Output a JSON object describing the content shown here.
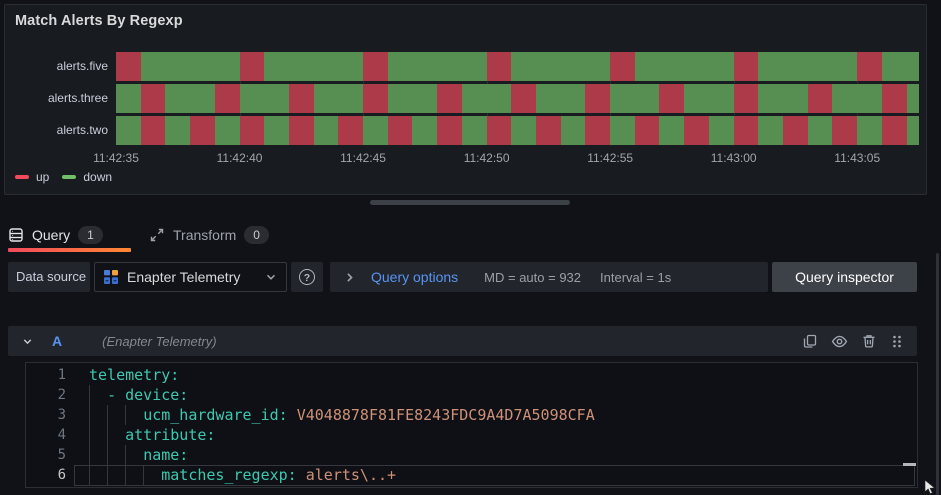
{
  "panel": {
    "title": "Match Alerts By Regexp"
  },
  "chart_data": {
    "type": "state_timeline",
    "title": "Match Alerts By Regexp",
    "x_start_s": 35,
    "x_end_s": 67.5,
    "cell_duration_s": 1,
    "ticks": [
      {
        "label": "11:42:35",
        "s": 35
      },
      {
        "label": "11:42:40",
        "s": 40
      },
      {
        "label": "11:42:45",
        "s": 45
      },
      {
        "label": "11:42:50",
        "s": 50
      },
      {
        "label": "11:42:55",
        "s": 55
      },
      {
        "label": "11:43:00",
        "s": 60
      },
      {
        "label": "11:43:05",
        "s": 65
      }
    ],
    "state_colors": {
      "up": "#ad3a49",
      "down": "#578e52"
    },
    "legend": [
      {
        "label": "up",
        "color": "#f2495c"
      },
      {
        "label": "down",
        "color": "#73bf69"
      }
    ],
    "series": [
      {
        "name": "alerts.five",
        "states": [
          "up",
          "down",
          "down",
          "down",
          "down",
          "up",
          "down",
          "down",
          "down",
          "down",
          "up",
          "down",
          "down",
          "down",
          "down",
          "up",
          "down",
          "down",
          "down",
          "down",
          "up",
          "down",
          "down",
          "down",
          "down",
          "up",
          "down",
          "down",
          "down",
          "down",
          "up",
          "down",
          "down"
        ]
      },
      {
        "name": "alerts.three",
        "states": [
          "down",
          "up",
          "down",
          "down",
          "up",
          "down",
          "down",
          "up",
          "down",
          "down",
          "up",
          "down",
          "down",
          "up",
          "down",
          "down",
          "up",
          "down",
          "down",
          "up",
          "down",
          "down",
          "up",
          "down",
          "down",
          "up",
          "down",
          "down",
          "up",
          "down",
          "down",
          "up",
          "down"
        ]
      },
      {
        "name": "alerts.two",
        "states": [
          "down",
          "up",
          "down",
          "up",
          "down",
          "up",
          "down",
          "up",
          "down",
          "up",
          "down",
          "up",
          "down",
          "up",
          "down",
          "up",
          "down",
          "up",
          "down",
          "up",
          "down",
          "up",
          "down",
          "up",
          "down",
          "up",
          "down",
          "up",
          "down",
          "up",
          "down",
          "up",
          "down"
        ]
      }
    ]
  },
  "tabs": {
    "query": {
      "label": "Query",
      "count": "1"
    },
    "transform": {
      "label": "Transform",
      "count": "0"
    }
  },
  "toolbar": {
    "datasource_label": "Data source",
    "datasource_value": "Enapter Telemetry",
    "help_glyph": "?",
    "query_options_label": "Query options",
    "md_text": "MD = auto = 932",
    "interval_text": "Interval = 1s",
    "query_inspector_label": "Query inspector"
  },
  "query_row": {
    "ref_id": "A",
    "datasource_hint": "(Enapter Telemetry)"
  },
  "editor": {
    "language": "yaml",
    "lines": [
      {
        "num": "1",
        "indent": 0,
        "guides": [],
        "current": false,
        "tokens": [
          {
            "c": "key",
            "v": "telemetry:"
          }
        ]
      },
      {
        "num": "2",
        "indent": 2,
        "guides": [
          0
        ],
        "current": false,
        "tokens": [
          {
            "c": "key",
            "v": "- device:"
          }
        ]
      },
      {
        "num": "3",
        "indent": 6,
        "guides": [
          0,
          2,
          4
        ],
        "current": false,
        "tokens": [
          {
            "c": "key",
            "v": "ucm_hardware_id:"
          },
          {
            "c": "val",
            "v": " V4048878F81FE8243FDC9A4D7A5098CFA"
          }
        ]
      },
      {
        "num": "4",
        "indent": 4,
        "guides": [
          0,
          2
        ],
        "current": false,
        "tokens": [
          {
            "c": "key",
            "v": "attribute:"
          }
        ]
      },
      {
        "num": "5",
        "indent": 6,
        "guides": [
          0,
          2,
          4
        ],
        "current": false,
        "tokens": [
          {
            "c": "key",
            "v": "name:"
          }
        ]
      },
      {
        "num": "6",
        "indent": 8,
        "guides": [
          0,
          2,
          4,
          6
        ],
        "current": true,
        "tokens": [
          {
            "c": "key",
            "v": "matches_regexp:"
          },
          {
            "c": "val",
            "v": " alerts\\..+"
          }
        ]
      }
    ]
  }
}
